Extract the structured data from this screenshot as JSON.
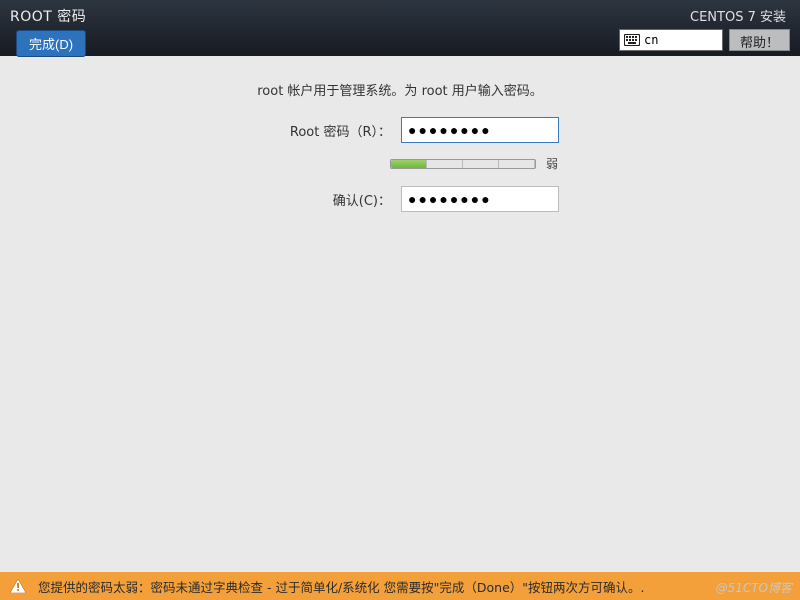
{
  "header": {
    "page_title": "ROOT 密码",
    "done_label": "完成(D)",
    "install_title": "CENTOS 7 安装",
    "lang_indicator": "cn",
    "help_label": "帮助！"
  },
  "main": {
    "description": "root 帐户用于管理系统。为 root 用户输入密码。",
    "password_label": "Root 密码（R）：",
    "password_value": "●●●●●●●●",
    "confirm_label": "确认(C)：",
    "confirm_value": "●●●●●●●●",
    "strength_text": "弱"
  },
  "warning": {
    "message": "您提供的密码太弱：密码未通过字典检查 - 过于简单化/系统化 您需要按\"完成（Done）\"按钮两次方可确认。."
  },
  "watermark": "@51CTO博客"
}
